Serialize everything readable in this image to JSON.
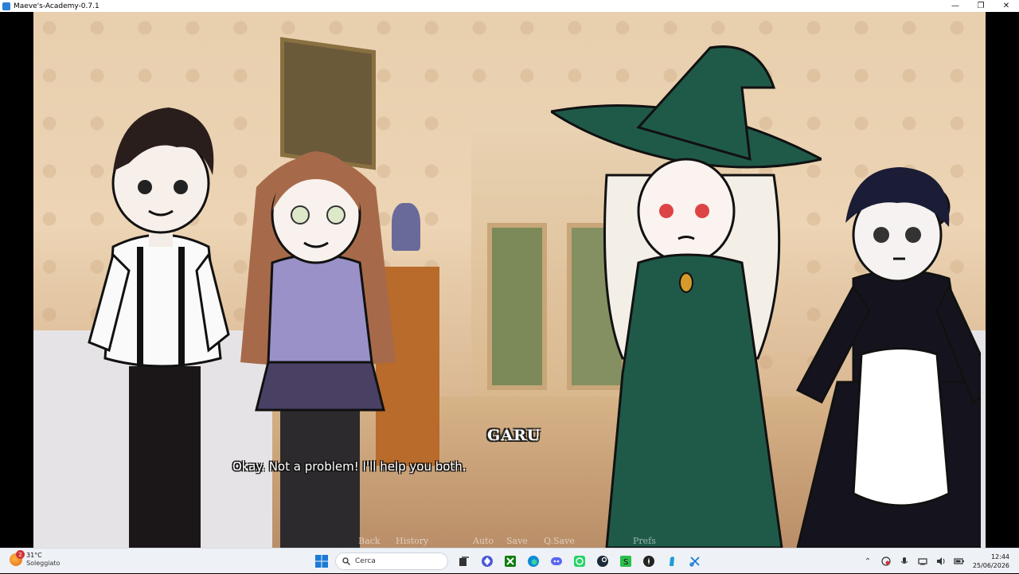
{
  "window": {
    "title": "Maeve's-Academy-0.7.1",
    "minimize": "—",
    "maximize": "❐",
    "close": "✕"
  },
  "dialogue": {
    "speaker": "GARU",
    "text": "Okay. Not a problem! I'll help you both."
  },
  "quick_menu": [
    "Back",
    "History",
    "Auto",
    "Save",
    "Q.Save",
    "Prefs"
  ],
  "taskbar": {
    "weather": {
      "badge": "2",
      "temperature": "31°C",
      "condition": "Soleggiato"
    },
    "search_placeholder": "Cerca",
    "clock": {
      "time": "12:44",
      "date": "25/06/2026"
    }
  },
  "colors": {
    "witch_green": "#1f5a48",
    "girl_skirt": "#4a4064",
    "maid_dress": "#15141e",
    "taskbar_bg": "#eef1f6"
  }
}
